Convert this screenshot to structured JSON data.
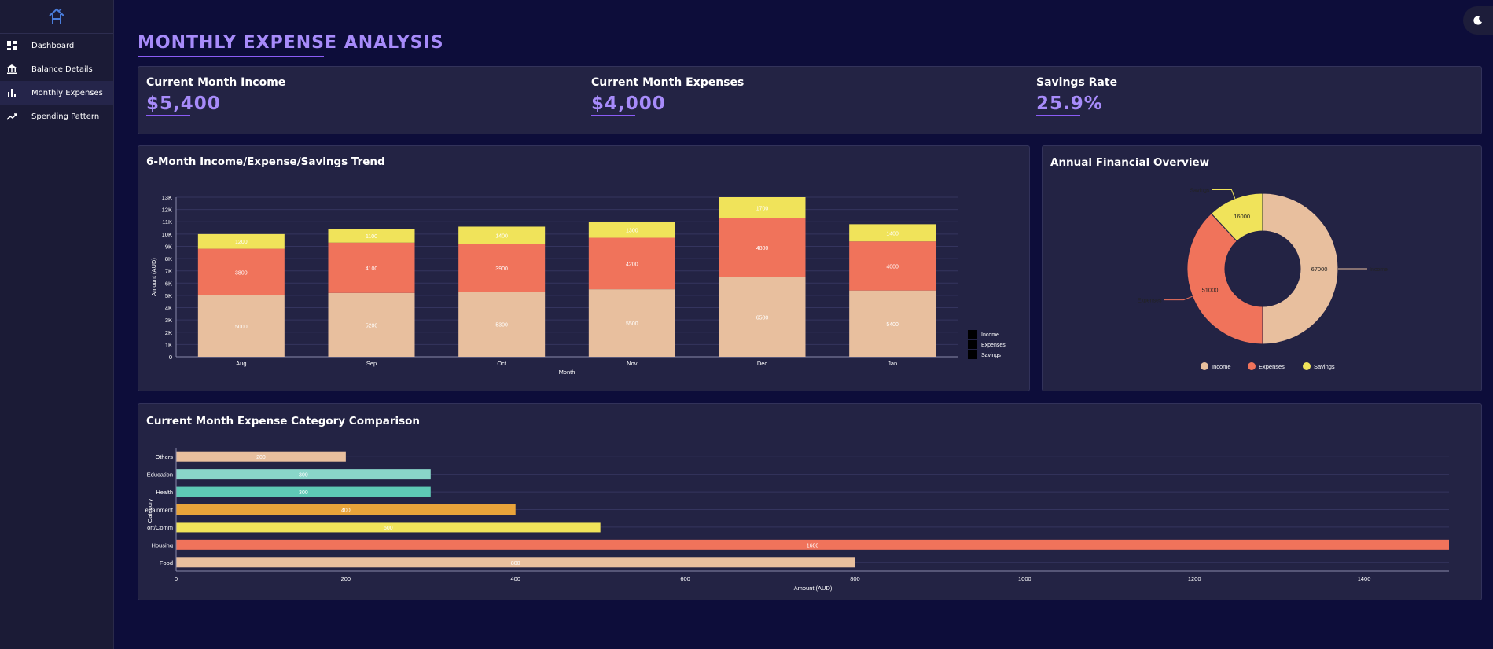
{
  "sidebar": {
    "logo_icon": "home-logo-icon",
    "items": [
      {
        "label": "Dashboard",
        "icon": "dashboard-icon",
        "active": false
      },
      {
        "label": "Balance Details",
        "icon": "bank-icon",
        "active": false
      },
      {
        "label": "Monthly Expenses",
        "icon": "bar-chart-icon",
        "active": true
      },
      {
        "label": "Spending Pattern",
        "icon": "trend-icon",
        "active": false
      }
    ]
  },
  "header": {
    "title": "MONTHLY EXPENSE ANALYSIS",
    "theme_toggle_icon": "moon-icon"
  },
  "stats": [
    {
      "label": "Current Month Income",
      "value": "$5,400"
    },
    {
      "label": "Current Month Expenses",
      "value": "$4,000"
    },
    {
      "label": "Savings Rate",
      "value": "25.9%"
    }
  ],
  "colors": {
    "income": "#e8bf9e",
    "expenses": "#f0735b",
    "savings": "#f0e35a",
    "accent": "#a78bfa"
  },
  "chart_data": [
    {
      "type": "bar",
      "stacked": true,
      "title": "6-Month Income/Expense/Savings Trend",
      "xlabel": "Month",
      "ylabel": "Amount (AUD)",
      "categories": [
        "Aug",
        "Sep",
        "Oct",
        "Nov",
        "Dec",
        "Jan"
      ],
      "series": [
        {
          "name": "Income",
          "values": [
            5000,
            5200,
            5300,
            5500,
            6500,
            5400
          ]
        },
        {
          "name": "Expenses",
          "values": [
            3800,
            4100,
            3900,
            4200,
            4800,
            4000
          ]
        },
        {
          "name": "Savings",
          "values": [
            1200,
            1100,
            1400,
            1300,
            1700,
            1400
          ]
        }
      ],
      "ylim": [
        0,
        13000
      ],
      "yticks": [
        "0",
        "1K",
        "2K",
        "3K",
        "4K",
        "5K",
        "6K",
        "7K",
        "8K",
        "9K",
        "10K",
        "11K",
        "12K",
        "13K"
      ],
      "grid": true,
      "legend": "bottom-right"
    },
    {
      "type": "pie",
      "donut": true,
      "title": "Annual Financial Overview",
      "labels": [
        "Income",
        "Expenses",
        "Savings"
      ],
      "values": [
        67000,
        51000,
        16000
      ],
      "legend": "bottom"
    },
    {
      "type": "bar",
      "orientation": "horizontal",
      "title": "Current Month Expense Category Comparison",
      "xlabel": "Amount (AUD)",
      "ylabel": "Category",
      "categories": [
        "Others",
        "Education",
        "Health",
        "Entertainment",
        "Transport/Comm",
        "Housing",
        "Food"
      ],
      "category_labels": [
        "Others",
        "Education",
        "Health",
        "ertainment",
        "ort/Comm",
        "Housing",
        "Food"
      ],
      "values": [
        200,
        300,
        300,
        400,
        500,
        1600,
        800
      ],
      "colors": [
        "#e8bf9e",
        "#89d6c9",
        "#5ec9b5",
        "#e8a33a",
        "#f0e35a",
        "#f0735b",
        "#e8bf9e"
      ],
      "xlim": [
        0,
        1500
      ],
      "xticks": [
        "0",
        "200",
        "400",
        "600",
        "800",
        "1000",
        "1200",
        "1400"
      ],
      "grid": true
    }
  ]
}
